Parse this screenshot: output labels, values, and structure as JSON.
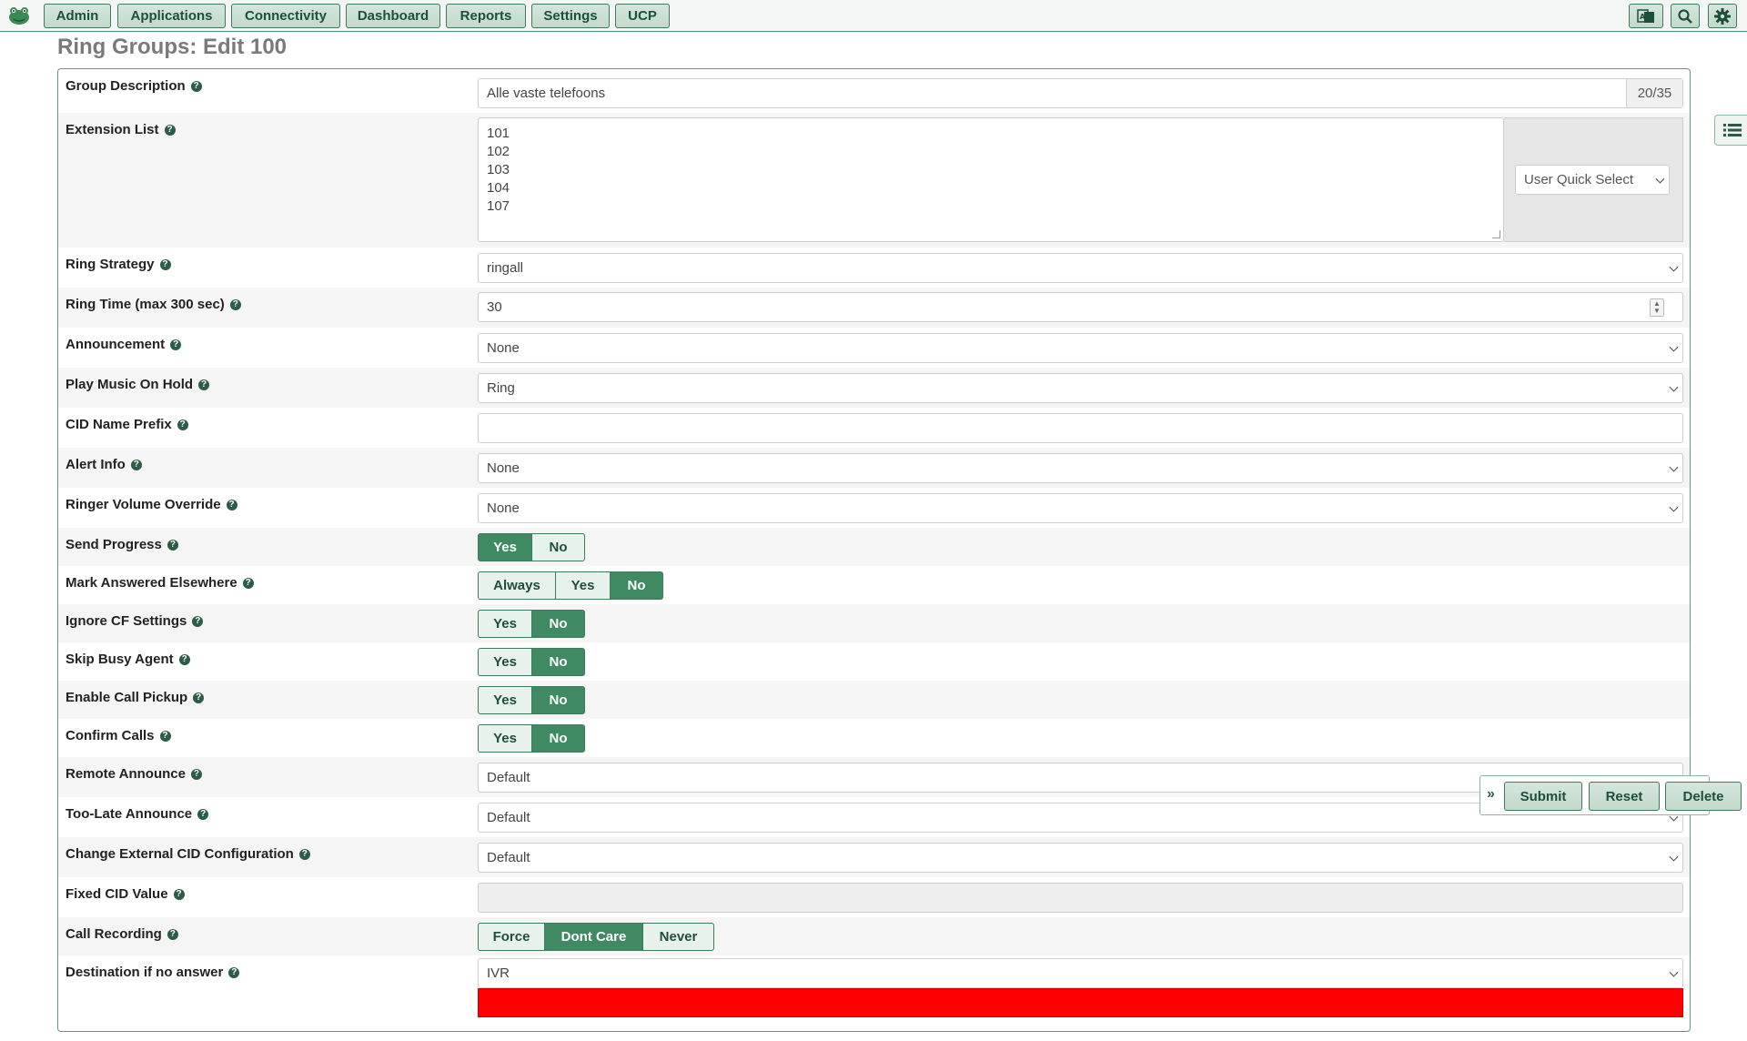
{
  "nav": {
    "items": [
      "Admin",
      "Applications",
      "Connectivity",
      "Dashboard",
      "Reports",
      "Settings",
      "UCP"
    ],
    "icons": [
      "language-icon",
      "search-icon",
      "gear-icon"
    ]
  },
  "page_title": "Ring Groups: Edit 100",
  "form": {
    "group_description": {
      "label": "Group Description",
      "value": "Alle vaste telefoons",
      "counter": "20/35"
    },
    "extension_list": {
      "label": "Extension List",
      "lines": [
        "101",
        "102",
        "103",
        "104",
        "107"
      ],
      "quick_select": "User Quick Select"
    },
    "ring_strategy": {
      "label": "Ring Strategy",
      "value": "ringall"
    },
    "ring_time": {
      "label": "Ring Time (max 300 sec)",
      "value": "30"
    },
    "announcement": {
      "label": "Announcement",
      "value": "None"
    },
    "play_moh": {
      "label": "Play Music On Hold",
      "value": "Ring"
    },
    "cid_prefix": {
      "label": "CID Name Prefix",
      "value": ""
    },
    "alert_info": {
      "label": "Alert Info",
      "value": "None"
    },
    "ringer_volume": {
      "label": "Ringer Volume Override",
      "value": "None"
    },
    "send_progress": {
      "label": "Send Progress",
      "options": [
        "Yes",
        "No"
      ],
      "selected": "Yes"
    },
    "mark_answered": {
      "label": "Mark Answered Elsewhere",
      "options": [
        "Always",
        "Yes",
        "No"
      ],
      "selected": "No"
    },
    "ignore_cf": {
      "label": "Ignore CF Settings",
      "options": [
        "Yes",
        "No"
      ],
      "selected": "No"
    },
    "skip_busy": {
      "label": "Skip Busy Agent",
      "options": [
        "Yes",
        "No"
      ],
      "selected": "No"
    },
    "call_pickup": {
      "label": "Enable Call Pickup",
      "options": [
        "Yes",
        "No"
      ],
      "selected": "No"
    },
    "confirm_calls": {
      "label": "Confirm Calls",
      "options": [
        "Yes",
        "No"
      ],
      "selected": "No"
    },
    "remote_announce": {
      "label": "Remote Announce",
      "value": "Default"
    },
    "too_late": {
      "label": "Too-Late Announce",
      "value": "Default"
    },
    "ext_cid": {
      "label": "Change External CID Configuration",
      "value": "Default"
    },
    "fixed_cid": {
      "label": "Fixed CID Value",
      "value": ""
    },
    "call_recording": {
      "label": "Call Recording",
      "options": [
        "Force",
        "Dont Care",
        "Never"
      ],
      "selected": "Dont Care"
    },
    "destination": {
      "label": "Destination if no answer",
      "value": "IVR"
    }
  },
  "actions": {
    "submit": "Submit",
    "reset": "Reset",
    "delete": "Delete",
    "toggle": "»"
  },
  "help_glyph": "?",
  "colors": {
    "accent": "#3f8a63",
    "error": "#ff0000"
  }
}
